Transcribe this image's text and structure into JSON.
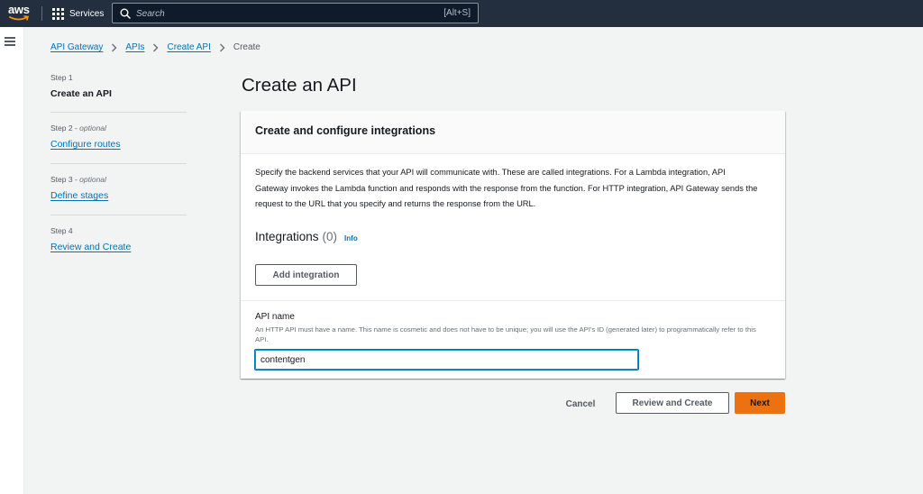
{
  "topnav": {
    "logo_text": "aws",
    "services_label": "Services",
    "search_placeholder": "Search",
    "search_shortcut": "[Alt+S]",
    "icons": {
      "services": "grid-icon",
      "search": "search-icon",
      "menu": "hamburger-icon"
    }
  },
  "breadcrumb": {
    "items": [
      "API Gateway",
      "APIs",
      "Create API"
    ],
    "current": "Create"
  },
  "steps": [
    {
      "number": "Step 1",
      "optional": "",
      "title": "Create an API"
    },
    {
      "number": "Step 2",
      "optional": "optional",
      "title": "Configure routes"
    },
    {
      "number": "Step 3",
      "optional": "optional",
      "title": "Define stages"
    },
    {
      "number": "Step 4",
      "optional": "",
      "title": "Review and Create"
    }
  ],
  "page_title": "Create an API",
  "panel": {
    "title": "Create and configure integrations",
    "description": "Specify the backend services that your API will communicate with. These are called integrations. For a Lambda integration, API Gateway invokes the Lambda function and responds with the response from the function. For HTTP integration, API Gateway sends the request to the URL that you specify and returns the response from the URL.",
    "integrations_label": "Integrations",
    "integrations_count": "(0)",
    "info_label": "Info",
    "add_integration_label": "Add integration",
    "api_name_label": "API name",
    "api_name_description": "An HTTP API must have a name. This name is cosmetic and does not have to be unique; you will use the API's ID (generated later) to programmatically refer to this API.",
    "api_name_value": "contentgen"
  },
  "footer": {
    "cancel_label": "Cancel",
    "review_label": "Review and Create",
    "next_label": "Next"
  },
  "colors": {
    "nav_bg": "#232f3e",
    "link": "#0073bb",
    "primary": "#ec7211",
    "page_bg": "#f2f3f3"
  }
}
